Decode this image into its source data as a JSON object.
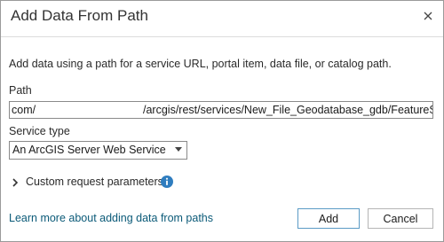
{
  "dialog": {
    "title": "Add Data From Path",
    "description": "Add data using a path for a service URL, portal item, data file, or catalog path.",
    "path_label": "Path",
    "path_value_start": "com/",
    "path_value_end": "/arcgis/rest/services/New_File_Geodatabase_gdb/FeatureServer",
    "service_type_label": "Service type",
    "service_type_value": "An ArcGIS Server Web Service",
    "custom_params_label": "Custom request parameters",
    "learn_more_link": "Learn more about adding data from paths",
    "add_button": "Add",
    "cancel_button": "Cancel"
  },
  "icons": {
    "close": "close-icon",
    "dropdown": "chevron-down-icon",
    "expand": "chevron-right-icon",
    "info": "info-icon"
  },
  "colors": {
    "link": "#0b5a78",
    "info_icon": "#2f7dbf",
    "primary_button_border": "#5b9bc5"
  }
}
